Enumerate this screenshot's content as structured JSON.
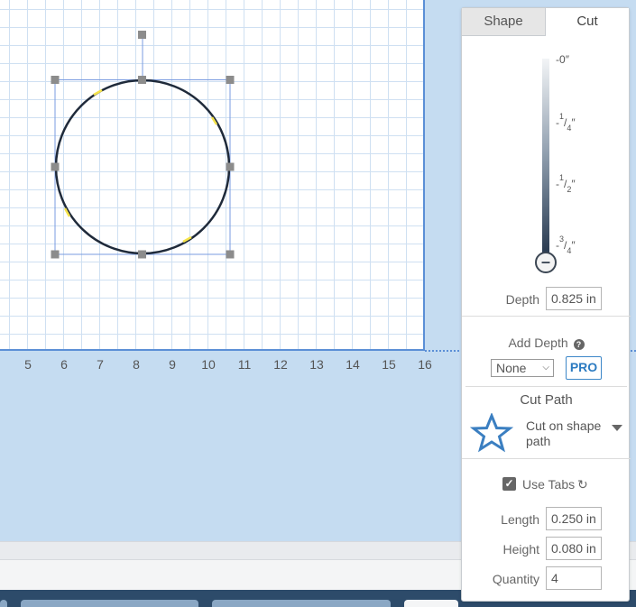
{
  "ruler": {
    "ticks": [
      "5",
      "6",
      "7",
      "8",
      "9",
      "10",
      "11",
      "12",
      "13",
      "14",
      "15",
      "16"
    ]
  },
  "panel": {
    "tabs": [
      {
        "label": "Shape",
        "active": false
      },
      {
        "label": "Cut",
        "active": true
      }
    ],
    "depth_gauge": {
      "labels": [
        {
          "sign": "-",
          "whole": "0",
          "num": "",
          "den": "",
          "unit": "″"
        },
        {
          "sign": "-",
          "whole": "",
          "num": "1",
          "den": "4",
          "unit": "″"
        },
        {
          "sign": "-",
          "whole": "",
          "num": "1",
          "den": "2",
          "unit": "″"
        },
        {
          "sign": "-",
          "whole": "",
          "num": "3",
          "den": "4",
          "unit": "″"
        }
      ],
      "knob_icon": "minus-icon"
    },
    "depth": {
      "label": "Depth",
      "value": "0.825 in"
    },
    "add_depth": {
      "label": "Add Depth",
      "help_icon": "question-circle-icon",
      "selected": "None",
      "pro_badge": "PRO"
    },
    "cut_path": {
      "title": "Cut Path",
      "icon": "star-icon",
      "value": "Cut on shape path"
    },
    "tabs_settings": {
      "use_tabs_label": "Use Tabs",
      "use_tabs_checked": true,
      "refresh_icon": "refresh-icon",
      "length": {
        "label": "Length",
        "value": "0.250 in"
      },
      "height": {
        "label": "Height",
        "value": "0.080 in"
      },
      "quantity": {
        "label": "Quantity",
        "value": "4"
      }
    }
  },
  "colors": {
    "canvas_background": "#c5dcf1",
    "board_border": "#5b8fd6",
    "selection": "#7a9be0",
    "shape_stroke": "#1f2a3a",
    "tab_marker": "#f5e34a",
    "pro_badge": "#2c7bc1",
    "star": "#3b7fc1"
  }
}
